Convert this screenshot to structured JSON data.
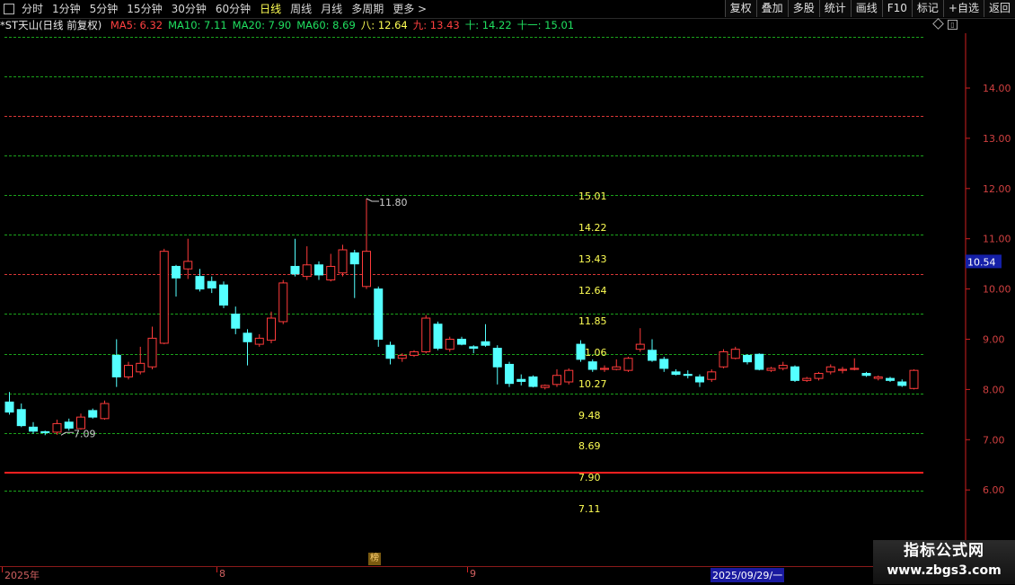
{
  "toolbar": {
    "tabs": [
      {
        "label": "分时",
        "active": false
      },
      {
        "label": "1分钟",
        "active": false
      },
      {
        "label": "5分钟",
        "active": false
      },
      {
        "label": "15分钟",
        "active": false
      },
      {
        "label": "30分钟",
        "active": false
      },
      {
        "label": "60分钟",
        "active": false
      },
      {
        "label": "日线",
        "active": true
      },
      {
        "label": "周线",
        "active": false
      },
      {
        "label": "月线",
        "active": false
      },
      {
        "label": "多周期",
        "active": false
      },
      {
        "label": "更多 >",
        "active": false
      }
    ],
    "right_buttons": [
      "复权",
      "叠加",
      "多股",
      "统计",
      "画线",
      "F10",
      "标记",
      "+自选",
      "返回"
    ]
  },
  "info": {
    "title": "*ST天山(日线 前复权)",
    "items": [
      {
        "text": "MA5: 6.32",
        "color": "#ff4040"
      },
      {
        "text": "MA10: 7.11",
        "color": "#20e060"
      },
      {
        "text": "MA20: 7.90",
        "color": "#20e060"
      },
      {
        "text": "MA60: 8.69",
        "color": "#20e060"
      },
      {
        "text": "八: 12.64",
        "color": "#ffff54"
      },
      {
        "text": "九: 13.43",
        "color": "#ff4040"
      },
      {
        "text": "十: 14.22",
        "color": "#20e060"
      },
      {
        "text": "十一: 15.01",
        "color": "#20e060"
      }
    ]
  },
  "chart_data": {
    "type": "candlestick",
    "ylim": [
      5.25,
      15.1
    ],
    "y_ticks": [
      "14.00",
      "13.00",
      "12.00",
      "11.00",
      "10.00",
      "9.00",
      "8.00",
      "7.00",
      "6.00"
    ],
    "current_price": "10.54",
    "levels": [
      {
        "label": "",
        "value": 15.01,
        "color": "#20c020"
      },
      {
        "label": "",
        "value": 14.22,
        "color": "#20c020"
      },
      {
        "label": "",
        "value": 13.43,
        "color": "#ff4040"
      },
      {
        "label": "",
        "value": 12.64,
        "color": "#20c020"
      },
      {
        "label": "15.01",
        "value": 11.85,
        "color": "#20c020"
      },
      {
        "label": "14.22",
        "value": 11.06,
        "color": "#20c020"
      },
      {
        "label": "13.43",
        "value": 10.27,
        "color": "#ff4040"
      },
      {
        "label": "12.64",
        "value": 9.48,
        "color": "#20c020"
      },
      {
        "label": "11.85",
        "value": 8.69,
        "color": "#20c020"
      },
      {
        "label": "11.06",
        "value": 7.9,
        "color": "#20c020"
      },
      {
        "label": "10.27",
        "value": 7.11,
        "color": "#20c020"
      },
      {
        "label": "9.48",
        "value": null,
        "color": "#20c020"
      },
      {
        "label": "8.69",
        "value": null,
        "color": "#20c020"
      },
      {
        "label": "7.90",
        "value": 6.32,
        "color": "#ff2020"
      },
      {
        "label": "7.11",
        "value": null,
        "color": "#20c020"
      }
    ],
    "annotations": [
      {
        "text": "11.80",
        "value": 11.8
      },
      {
        "text": "7.09",
        "value": 7.09
      }
    ],
    "candles": [
      {
        "o": 7.75,
        "c": 7.55,
        "h": 7.95,
        "l": 7.5
      },
      {
        "o": 7.6,
        "c": 7.28,
        "h": 7.72,
        "l": 7.25
      },
      {
        "o": 7.25,
        "c": 7.17,
        "h": 7.35,
        "l": 7.12
      },
      {
        "o": 7.16,
        "c": 7.14,
        "h": 7.18,
        "l": 7.09
      },
      {
        "o": 7.15,
        "c": 7.32,
        "h": 7.4,
        "l": 7.1
      },
      {
        "o": 7.35,
        "c": 7.23,
        "h": 7.42,
        "l": 7.18
      },
      {
        "o": 7.22,
        "c": 7.45,
        "h": 7.52,
        "l": 7.2
      },
      {
        "o": 7.58,
        "c": 7.45,
        "h": 7.62,
        "l": 7.42
      },
      {
        "o": 7.42,
        "c": 7.72,
        "h": 7.78,
        "l": 7.4
      },
      {
        "o": 8.68,
        "c": 8.25,
        "h": 9.0,
        "l": 8.05
      },
      {
        "o": 8.25,
        "c": 8.48,
        "h": 8.55,
        "l": 8.2
      },
      {
        "o": 8.35,
        "c": 8.52,
        "h": 8.85,
        "l": 8.3
      },
      {
        "o": 8.45,
        "c": 9.02,
        "h": 9.25,
        "l": 8.4
      },
      {
        "o": 8.92,
        "c": 10.75,
        "h": 10.8,
        "l": 8.9
      },
      {
        "o": 10.45,
        "c": 10.22,
        "h": 10.48,
        "l": 9.85
      },
      {
        "o": 10.4,
        "c": 10.55,
        "h": 11.0,
        "l": 10.2
      },
      {
        "o": 10.25,
        "c": 10.0,
        "h": 10.4,
        "l": 9.95
      },
      {
        "o": 10.15,
        "c": 10.02,
        "h": 10.25,
        "l": 9.92
      },
      {
        "o": 10.08,
        "c": 9.68,
        "h": 10.15,
        "l": 9.62
      },
      {
        "o": 9.5,
        "c": 9.22,
        "h": 9.65,
        "l": 9.1
      },
      {
        "o": 9.12,
        "c": 8.95,
        "h": 9.2,
        "l": 8.48
      },
      {
        "o": 8.9,
        "c": 9.02,
        "h": 9.1,
        "l": 8.85
      },
      {
        "o": 8.98,
        "c": 9.42,
        "h": 9.55,
        "l": 8.92
      },
      {
        "o": 9.35,
        "c": 10.12,
        "h": 10.18,
        "l": 9.3
      },
      {
        "o": 10.45,
        "c": 10.3,
        "h": 11.0,
        "l": 10.25
      },
      {
        "o": 10.25,
        "c": 10.48,
        "h": 10.85,
        "l": 10.18
      },
      {
        "o": 10.48,
        "c": 10.28,
        "h": 10.55,
        "l": 10.18
      },
      {
        "o": 10.18,
        "c": 10.45,
        "h": 10.7,
        "l": 10.15
      },
      {
        "o": 10.32,
        "c": 10.78,
        "h": 10.88,
        "l": 10.25
      },
      {
        "o": 10.72,
        "c": 10.5,
        "h": 10.78,
        "l": 9.82
      },
      {
        "o": 10.05,
        "c": 10.75,
        "h": 11.8,
        "l": 10.0
      },
      {
        "o": 10.0,
        "c": 9.0,
        "h": 10.05,
        "l": 8.85
      },
      {
        "o": 8.88,
        "c": 8.62,
        "h": 8.95,
        "l": 8.5
      },
      {
        "o": 8.62,
        "c": 8.68,
        "h": 8.72,
        "l": 8.55
      },
      {
        "o": 8.68,
        "c": 8.75,
        "h": 8.78,
        "l": 8.65
      },
      {
        "o": 8.75,
        "c": 9.42,
        "h": 9.48,
        "l": 8.72
      },
      {
        "o": 9.3,
        "c": 8.82,
        "h": 9.35,
        "l": 8.78
      },
      {
        "o": 8.8,
        "c": 9.0,
        "h": 9.05,
        "l": 8.75
      },
      {
        "o": 9.0,
        "c": 8.9,
        "h": 9.05,
        "l": 8.88
      },
      {
        "o": 8.85,
        "c": 8.82,
        "h": 8.88,
        "l": 8.72
      },
      {
        "o": 8.95,
        "c": 8.88,
        "h": 9.3,
        "l": 8.85
      },
      {
        "o": 8.82,
        "c": 8.45,
        "h": 8.88,
        "l": 8.1
      },
      {
        "o": 8.5,
        "c": 8.12,
        "h": 8.55,
        "l": 8.05
      },
      {
        "o": 8.2,
        "c": 8.16,
        "h": 8.3,
        "l": 8.08
      },
      {
        "o": 8.25,
        "c": 8.06,
        "h": 8.28,
        "l": 8.04
      },
      {
        "o": 8.04,
        "c": 8.08,
        "h": 8.1,
        "l": 8.0
      },
      {
        "o": 8.1,
        "c": 8.28,
        "h": 8.4,
        "l": 8.05
      },
      {
        "o": 8.15,
        "c": 8.38,
        "h": 8.42,
        "l": 8.1
      },
      {
        "o": 8.9,
        "c": 8.6,
        "h": 8.98,
        "l": 8.55
      },
      {
        "o": 8.55,
        "c": 8.4,
        "h": 8.6,
        "l": 8.35
      },
      {
        "o": 8.4,
        "c": 8.42,
        "h": 8.48,
        "l": 8.35
      },
      {
        "o": 8.4,
        "c": 8.45,
        "h": 8.6,
        "l": 8.38
      },
      {
        "o": 8.38,
        "c": 8.62,
        "h": 8.65,
        "l": 8.35
      },
      {
        "o": 8.8,
        "c": 8.9,
        "h": 9.22,
        "l": 8.75
      },
      {
        "o": 8.78,
        "c": 8.58,
        "h": 9.0,
        "l": 8.55
      },
      {
        "o": 8.6,
        "c": 8.42,
        "h": 8.65,
        "l": 8.35
      },
      {
        "o": 8.35,
        "c": 8.3,
        "h": 8.4,
        "l": 8.28
      },
      {
        "o": 8.3,
        "c": 8.28,
        "h": 8.38,
        "l": 8.22
      },
      {
        "o": 8.25,
        "c": 8.15,
        "h": 8.3,
        "l": 8.05
      },
      {
        "o": 8.2,
        "c": 8.35,
        "h": 8.4,
        "l": 8.15
      },
      {
        "o": 8.45,
        "c": 8.75,
        "h": 8.8,
        "l": 8.42
      },
      {
        "o": 8.62,
        "c": 8.8,
        "h": 8.85,
        "l": 8.6
      },
      {
        "o": 8.68,
        "c": 8.55,
        "h": 8.7,
        "l": 8.5
      },
      {
        "o": 8.7,
        "c": 8.4,
        "h": 8.72,
        "l": 8.38
      },
      {
        "o": 8.38,
        "c": 8.42,
        "h": 8.45,
        "l": 8.35
      },
      {
        "o": 8.42,
        "c": 8.48,
        "h": 8.55,
        "l": 8.38
      },
      {
        "o": 8.45,
        "c": 8.18,
        "h": 8.48,
        "l": 8.15
      },
      {
        "o": 8.18,
        "c": 8.22,
        "h": 8.25,
        "l": 8.15
      },
      {
        "o": 8.22,
        "c": 8.32,
        "h": 8.35,
        "l": 8.18
      },
      {
        "o": 8.35,
        "c": 8.45,
        "h": 8.5,
        "l": 8.3
      },
      {
        "o": 8.38,
        "c": 8.4,
        "h": 8.45,
        "l": 8.32
      },
      {
        "o": 8.4,
        "c": 8.42,
        "h": 8.62,
        "l": 8.38
      },
      {
        "o": 8.32,
        "c": 8.28,
        "h": 8.35,
        "l": 8.25
      },
      {
        "o": 8.22,
        "c": 8.25,
        "h": 8.28,
        "l": 8.18
      },
      {
        "o": 8.22,
        "c": 8.18,
        "h": 8.25,
        "l": 8.15
      },
      {
        "o": 8.15,
        "c": 8.08,
        "h": 8.2,
        "l": 8.05
      },
      {
        "o": 8.02,
        "c": 8.38,
        "h": 8.4,
        "l": 8.0
      }
    ],
    "x_labels": [
      {
        "text": "2025年"
      },
      {
        "text": "8"
      },
      {
        "text": "9"
      }
    ],
    "crosshair_date": "2025/09/29/一",
    "marker": "榜"
  },
  "watermark": {
    "line1": "指标公式网",
    "line2": "www.zbgs3.com"
  },
  "colors": {
    "up": "#ff3b3b",
    "down": "#54ffff",
    "grid_green": "#1fa81f",
    "grid_red": "#b01818",
    "axis_red": "#d02020",
    "level_text": "#ffff54"
  }
}
